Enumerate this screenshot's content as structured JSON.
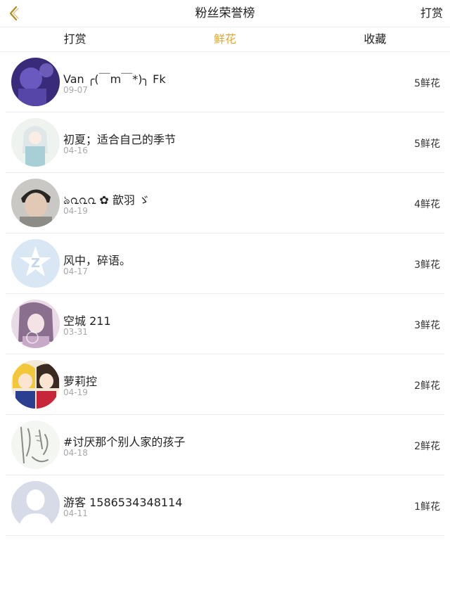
{
  "header": {
    "title": "粉丝荣誉榜",
    "right_action": "打赏",
    "back_icon": "chevron-left-icon",
    "accent_color": "#e3a72b"
  },
  "tabs": [
    {
      "label": "打赏",
      "active": false
    },
    {
      "label": "鲜花",
      "active": true
    },
    {
      "label": "收藏",
      "active": false
    }
  ],
  "fans": [
    {
      "name": "Van ╭(￣m￣*)╮ Fk",
      "date": "09-07",
      "count": "5鲜花",
      "avatar": "avatar-purple-portrait"
    },
    {
      "name": "初夏；适合自己的季节",
      "date": "04-16",
      "count": "5鲜花",
      "avatar": "avatar-anime-girl-white"
    },
    {
      "name": "ঌ൨൨൨ ✿ 歆羽 ゞ",
      "date": "04-19",
      "count": "4鲜花",
      "avatar": "avatar-boy-photo"
    },
    {
      "name": "风中，碎语。",
      "date": "04-17",
      "count": "3鲜花",
      "avatar": "avatar-qq-default"
    },
    {
      "name": "空城 211",
      "date": "03-31",
      "count": "3鲜花",
      "avatar": "avatar-anime-girl-pink"
    },
    {
      "name": "萝莉控",
      "date": "04-19",
      "count": "2鲜花",
      "avatar": "avatar-anime-duo"
    },
    {
      "name": "#讨厌那个别人家的孩子",
      "date": "04-18",
      "count": "2鲜花",
      "avatar": "avatar-sketch-drawing"
    },
    {
      "name": "游客 1586534348114",
      "date": "04-11",
      "count": "1鲜花",
      "avatar": "avatar-default-person"
    }
  ]
}
